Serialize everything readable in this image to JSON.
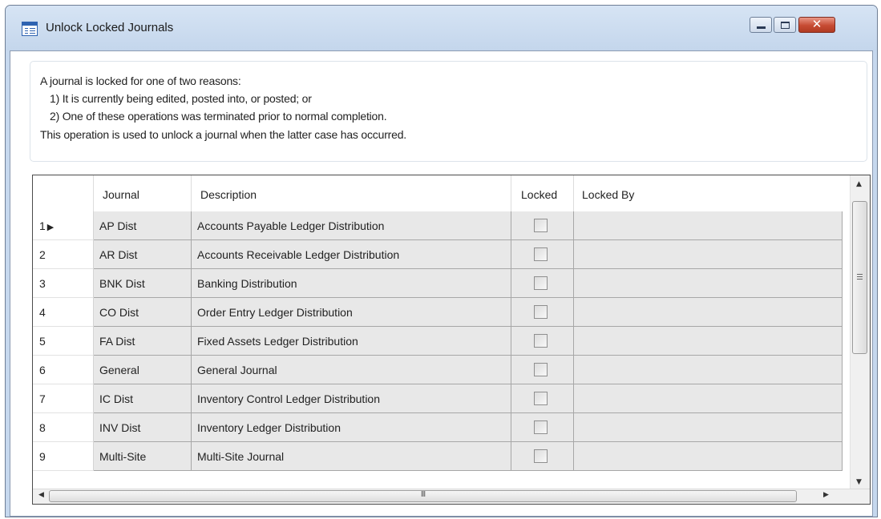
{
  "window": {
    "title": "Unlock Locked Journals",
    "close_glyph": "✕"
  },
  "info": {
    "lines": [
      "A journal is locked for one of two reasons:",
      "1) It is currently being edited, posted into, or posted; or",
      "2) One of these operations was terminated prior to normal completion.",
      "This operation is used to unlock a journal when the latter case has occurred."
    ]
  },
  "grid": {
    "columns": [
      "Journal",
      "Description",
      "Locked",
      "Locked By"
    ],
    "current_row_marker": "▶",
    "rows": [
      {
        "num": "1",
        "journal": "AP Dist",
        "description": "Accounts Payable Ledger Distribution",
        "locked": false,
        "locked_by": ""
      },
      {
        "num": "2",
        "journal": "AR Dist",
        "description": "Accounts Receivable Ledger Distribution",
        "locked": false,
        "locked_by": ""
      },
      {
        "num": "3",
        "journal": "BNK Dist",
        "description": "Banking Distribution",
        "locked": false,
        "locked_by": ""
      },
      {
        "num": "4",
        "journal": "CO Dist",
        "description": "Order Entry Ledger Distribution",
        "locked": false,
        "locked_by": ""
      },
      {
        "num": "5",
        "journal": "FA Dist",
        "description": "Fixed Assets Ledger Distribution",
        "locked": false,
        "locked_by": ""
      },
      {
        "num": "6",
        "journal": "General",
        "description": "General Journal",
        "locked": false,
        "locked_by": ""
      },
      {
        "num": "7",
        "journal": "IC Dist",
        "description": "Inventory Control Ledger Distribution",
        "locked": false,
        "locked_by": ""
      },
      {
        "num": "8",
        "journal": "INV Dist",
        "description": "Inventory Ledger Distribution",
        "locked": false,
        "locked_by": ""
      },
      {
        "num": "9",
        "journal": "Multi-Site",
        "description": "Multi-Site Journal",
        "locked": false,
        "locked_by": ""
      }
    ]
  },
  "scrollbars": {
    "up_arrow": "▲",
    "down_arrow": "▼",
    "left_arrow": "◀",
    "right_arrow": "▶",
    "h_grip": "III"
  },
  "colors": {
    "title_bar": "#c6d8ee",
    "close_button": "#c64b33",
    "cell_background": "#e8e8e8"
  }
}
